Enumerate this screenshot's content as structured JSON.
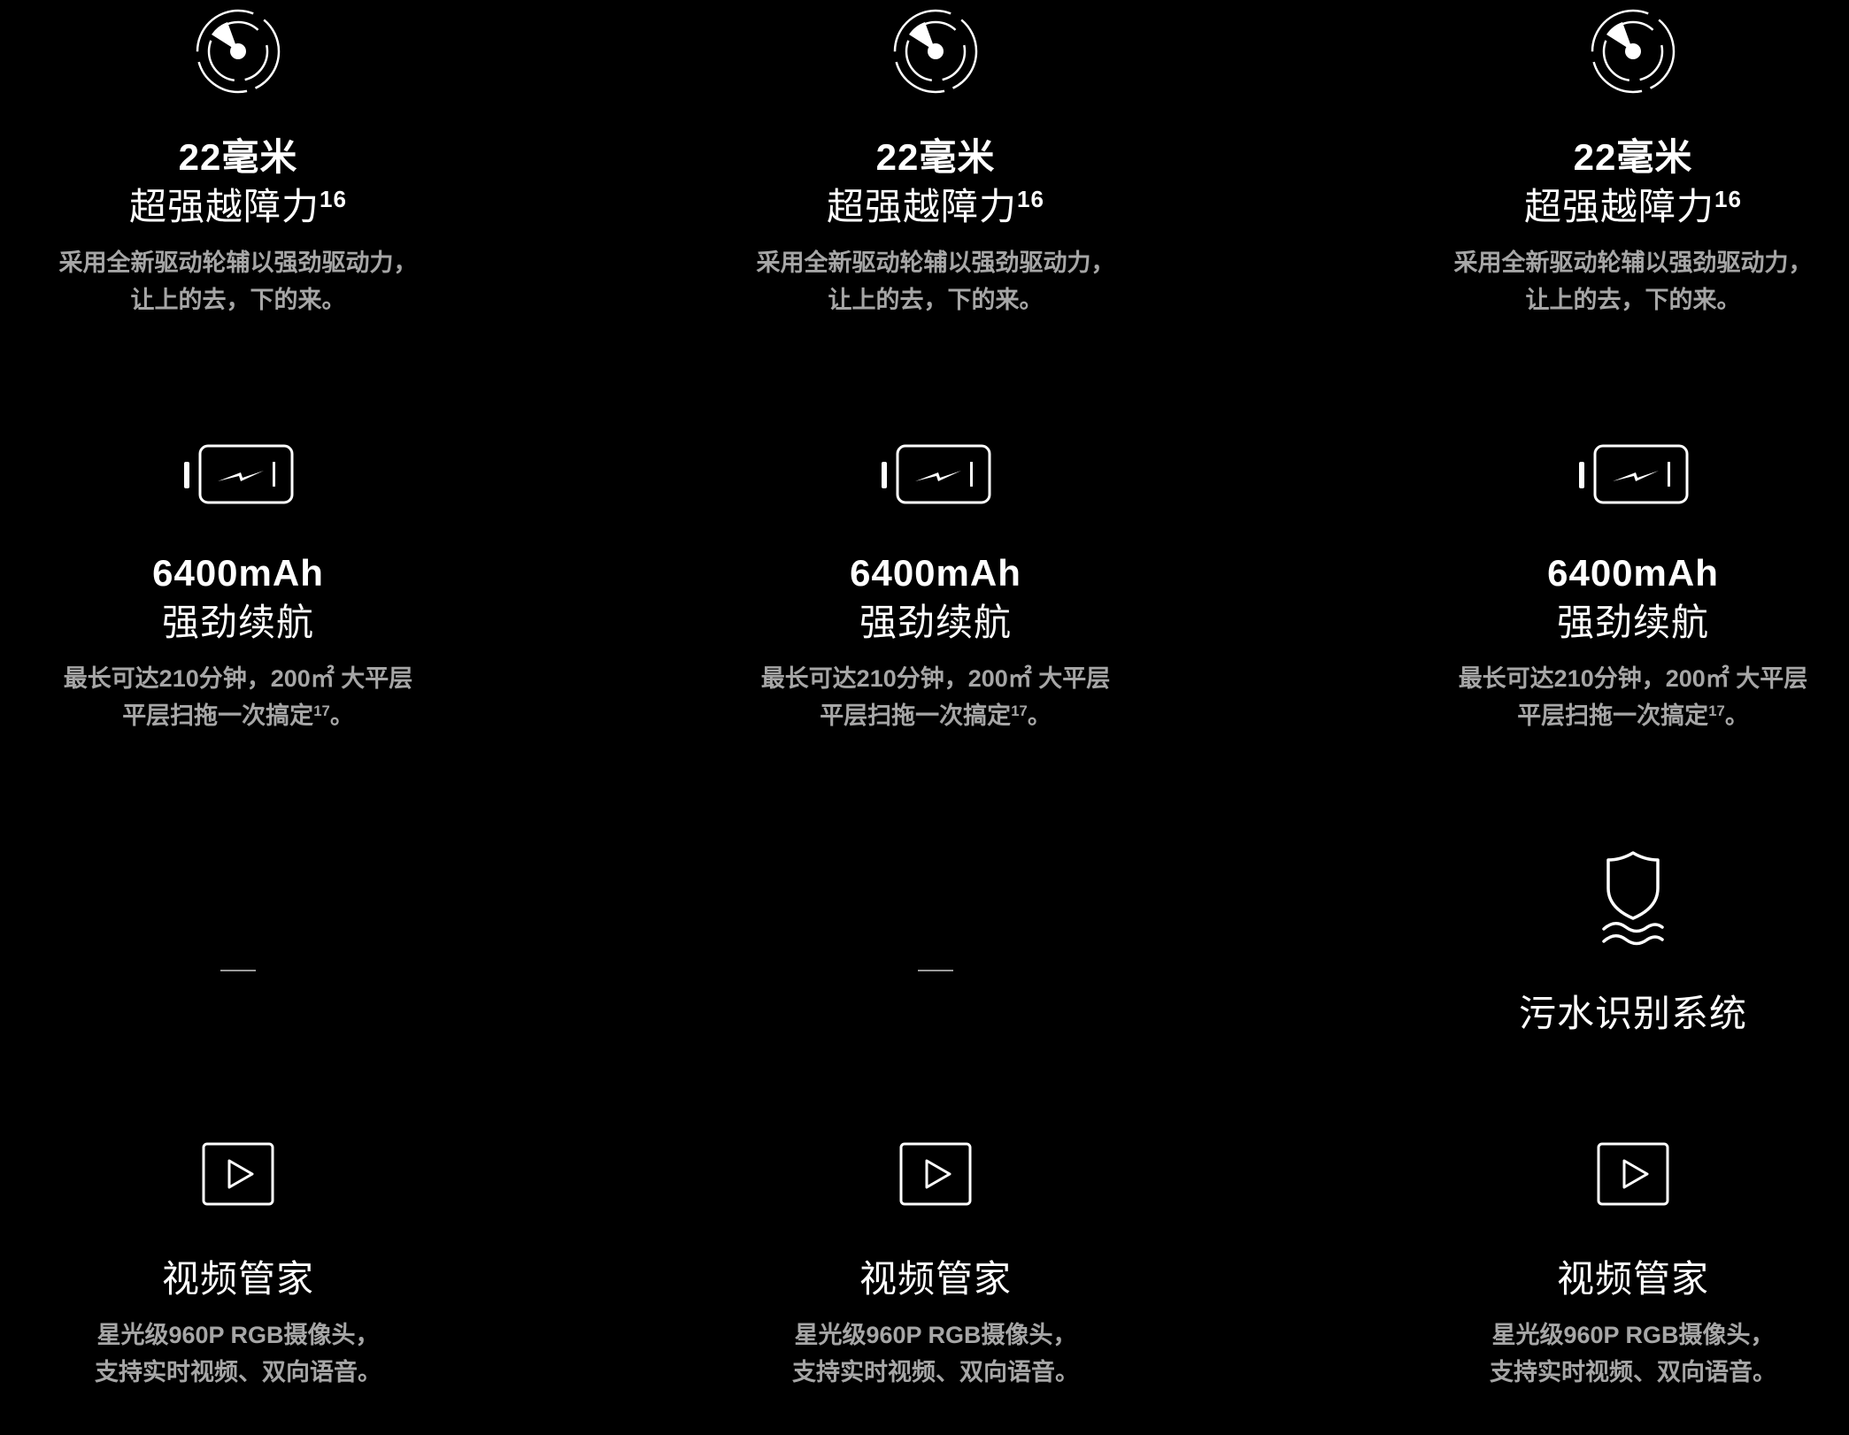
{
  "columns": [
    {
      "obstacle": {
        "icon": "radar-icon",
        "title_num": "22毫米",
        "title_text": "超强越障力",
        "title_sup": "16",
        "desc_line1": "采用全新驱动轮辅以强劲驱动力，",
        "desc_line2": "让上的去，下的来。"
      },
      "battery": {
        "icon": "battery-icon",
        "title_num": "6400mAh",
        "title_text": "强劲续航",
        "desc_line1": "最长可达210分钟，200㎡ 大平层",
        "desc_line2_main": "平层扫拖一次搞定",
        "desc_line2_sup": "17",
        "desc_line2_end": "。"
      },
      "third": {
        "type": "dash",
        "dash": "—"
      },
      "video": {
        "icon": "play-icon",
        "title": "视频管家",
        "desc_line1": "星光级960P RGB摄像头，",
        "desc_line2": "支持实时视频、双向语音。"
      }
    },
    {
      "obstacle": {
        "icon": "radar-icon",
        "title_num": "22毫米",
        "title_text": "超强越障力",
        "title_sup": "16",
        "desc_line1": "采用全新驱动轮辅以强劲驱动力，",
        "desc_line2": "让上的去，下的来。"
      },
      "battery": {
        "icon": "battery-icon",
        "title_num": "6400mAh",
        "title_text": "强劲续航",
        "desc_line1": "最长可达210分钟，200㎡ 大平层",
        "desc_line2_main": "平层扫拖一次搞定",
        "desc_line2_sup": "17",
        "desc_line2_end": "。"
      },
      "third": {
        "type": "dash",
        "dash": "—"
      },
      "video": {
        "icon": "play-icon",
        "title": "视频管家",
        "desc_line1": "星光级960P RGB摄像头，",
        "desc_line2": "支持实时视频、双向语音。"
      }
    },
    {
      "obstacle": {
        "icon": "radar-icon",
        "title_num": "22毫米",
        "title_text": "超强越障力",
        "title_sup": "16",
        "desc_line1": "采用全新驱动轮辅以强劲驱动力，",
        "desc_line2": "让上的去，下的来。"
      },
      "battery": {
        "icon": "battery-icon",
        "title_num": "6400mAh",
        "title_text": "强劲续航",
        "desc_line1": "最长可达210分钟，200㎡ 大平层",
        "desc_line2_main": "平层扫拖一次搞定",
        "desc_line2_sup": "17",
        "desc_line2_end": "。"
      },
      "third": {
        "type": "shield",
        "icon": "shield-water-icon",
        "title": "污水识别系统"
      },
      "video": {
        "icon": "play-icon",
        "title": "视频管家",
        "desc_line1": "星光级960P RGB摄像头，",
        "desc_line2": "支持实时视频、双向语音。"
      }
    }
  ]
}
